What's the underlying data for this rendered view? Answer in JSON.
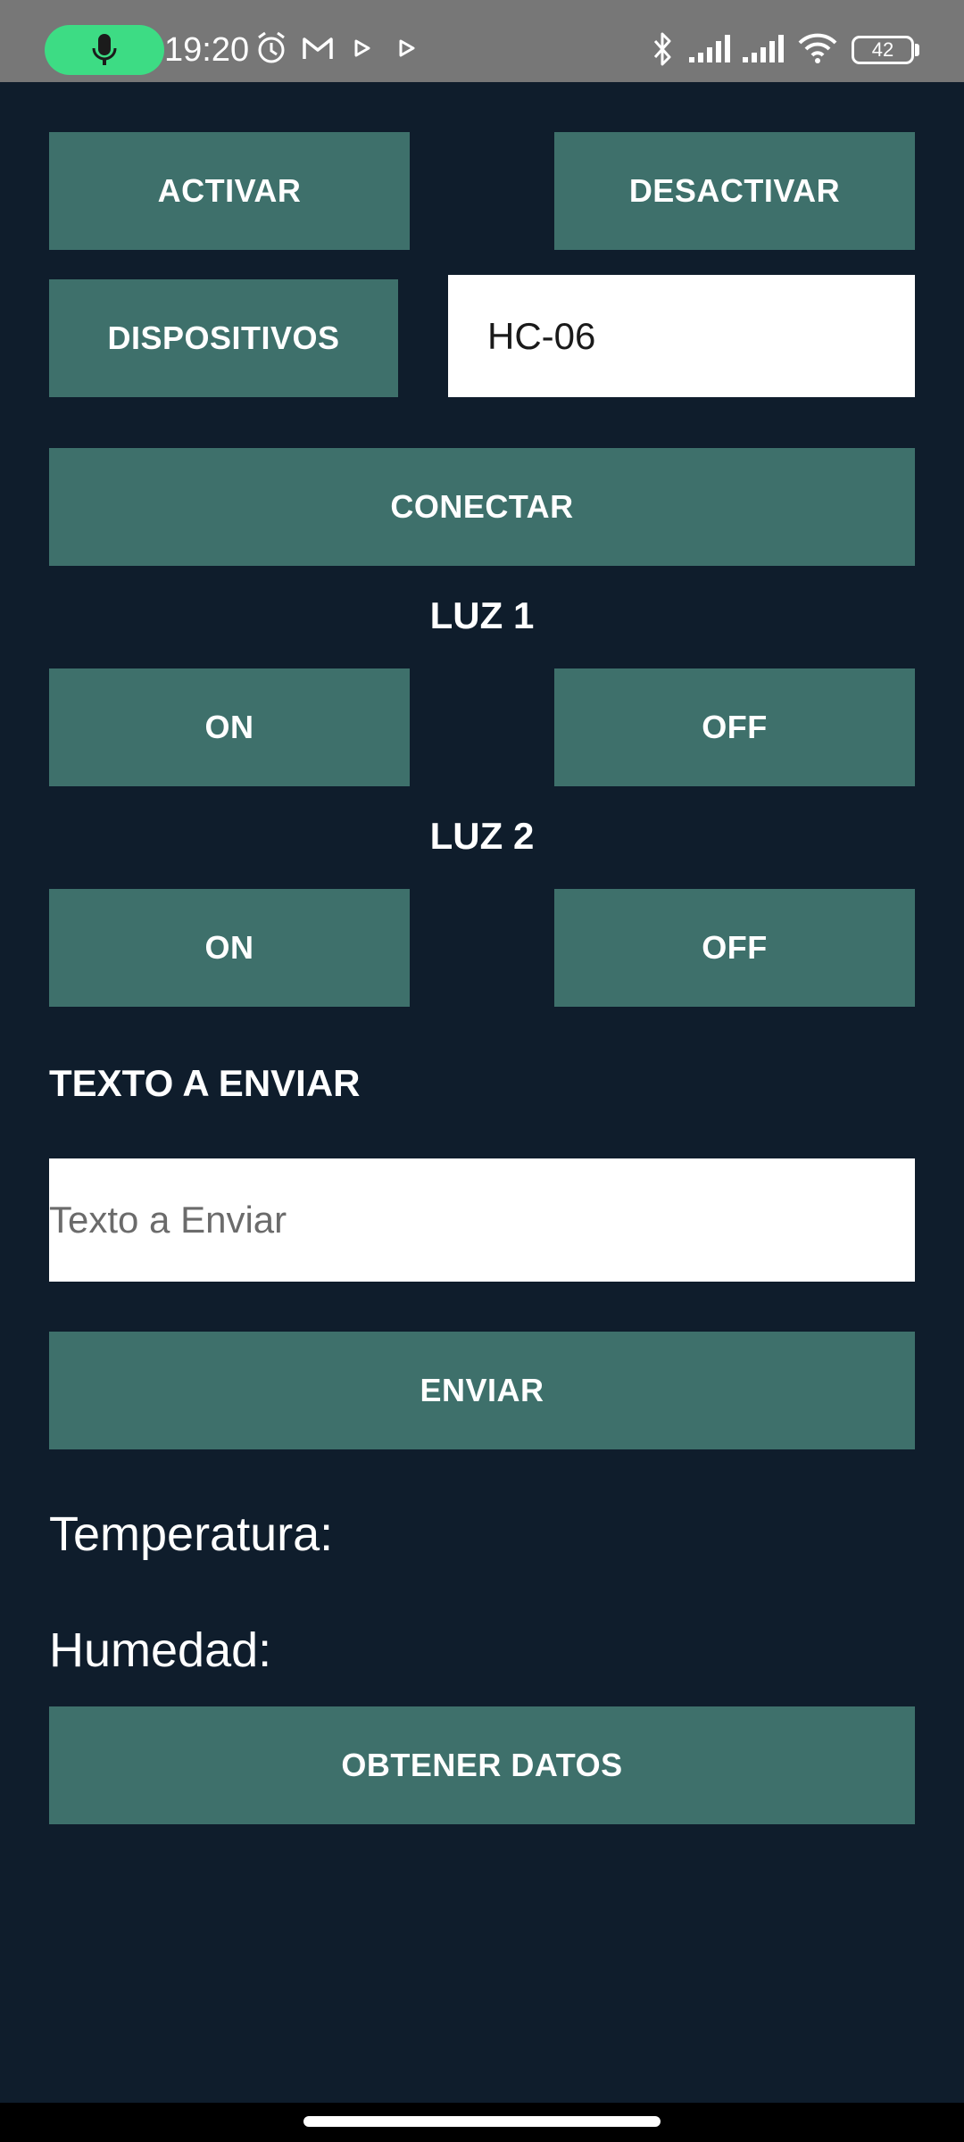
{
  "status_bar": {
    "time": "19:20",
    "battery": "42",
    "icons": [
      "mic-icon",
      "alarm-icon",
      "gmail-icon",
      "play-icon",
      "play-icon",
      "bluetooth-icon",
      "signal-icon",
      "signal-icon",
      "wifi-icon",
      "battery-icon"
    ],
    "colors": {
      "bar": "#777777",
      "mic_pill": "#3ddc84"
    }
  },
  "bluetooth": {
    "activate_label": "ACTIVAR",
    "deactivate_label": "DESACTIVAR",
    "devices_label": "DISPOSITIVOS",
    "device_value": "HC-06",
    "connect_label": "CONECTAR"
  },
  "light1": {
    "title": "LUZ 1",
    "on_label": "ON",
    "off_label": "OFF"
  },
  "light2": {
    "title": "LUZ 2",
    "on_label": "ON",
    "off_label": "OFF"
  },
  "send": {
    "heading": "TEXTO A ENVIAR",
    "placeholder": "Texto a Enviar",
    "value": "",
    "button_label": "ENVIAR"
  },
  "sensors": {
    "temperature_label": "Temperatura:",
    "humidity_label": "Humedad:",
    "fetch_label": "OBTENER DATOS"
  },
  "theme": {
    "background": "#0f1d2c",
    "button": "#3e706b",
    "field": "#ffffff"
  }
}
